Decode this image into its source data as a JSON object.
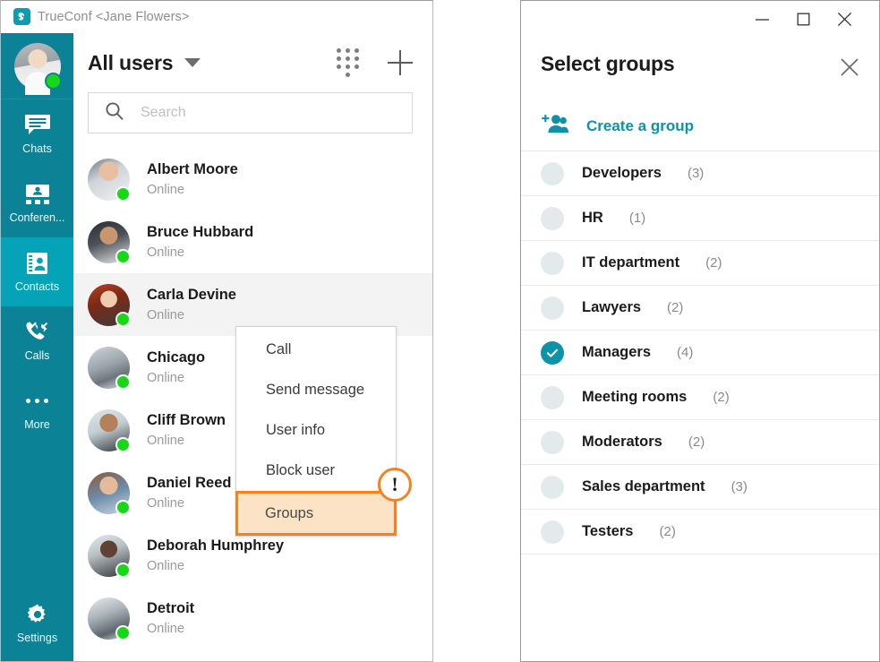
{
  "app": {
    "titlebar": {
      "brand": "TrueConf",
      "user": "<Jane Flowers>",
      "logo_icon": "trueconf-logo-icon"
    },
    "accent_teal": "#0b8296",
    "accent_teal_active": "#05a3b8",
    "accent_link": "#0c93a8",
    "highlight_orange": "#f58220",
    "highlight_fill": "#fde3c5",
    "presence_green": "#16d816"
  },
  "sidebar": {
    "profile": {
      "name": "Jane Flowers",
      "presence": "online",
      "avatar_icon": "avatar"
    },
    "items": [
      {
        "label": "Chats",
        "icon": "chat-bubble-icon",
        "active": false
      },
      {
        "label": "Conferen...",
        "icon": "conference-icon",
        "active": false
      },
      {
        "label": "Contacts",
        "icon": "contacts-card-icon",
        "active": true
      },
      {
        "label": "Calls",
        "icon": "call-arrows-icon",
        "active": false
      },
      {
        "label": "More",
        "icon": "ellipsis-icon",
        "active": false
      }
    ],
    "settings": {
      "label": "Settings",
      "icon": "gear-icon"
    }
  },
  "main": {
    "header": {
      "title": "All users",
      "dropdown_icon": "chevron-down-icon",
      "dialpad_icon": "dialpad-icon",
      "add_icon": "plus-icon"
    },
    "search": {
      "placeholder": "Search",
      "value": "",
      "icon": "search-icon"
    },
    "contacts": [
      {
        "name": "Albert Moore",
        "status": "Online",
        "selected": false
      },
      {
        "name": "Bruce Hubbard",
        "status": "Online",
        "selected": false
      },
      {
        "name": "Carla Devine",
        "status": "Online",
        "selected": true
      },
      {
        "name": "Chicago",
        "status": "Online",
        "selected": false
      },
      {
        "name": "Cliff Brown",
        "status": "Online",
        "selected": false
      },
      {
        "name": "Daniel Reed",
        "status": "Online",
        "selected": false
      },
      {
        "name": "Deborah Humphrey",
        "status": "Online",
        "selected": false
      },
      {
        "name": "Detroit",
        "status": "Online",
        "selected": false
      }
    ]
  },
  "context_menu": {
    "items": [
      {
        "label": "Call",
        "highlighted": false
      },
      {
        "label": "Send message",
        "highlighted": false
      },
      {
        "label": "User info",
        "highlighted": false
      },
      {
        "label": "Block user",
        "highlighted": false
      },
      {
        "label": "Groups",
        "highlighted": true
      }
    ],
    "badge": {
      "text": "!",
      "icon": "exclamation-badge-icon"
    }
  },
  "dialog": {
    "window_controls": {
      "minimize_icon": "minimize-icon",
      "maximize_icon": "maximize-icon",
      "close_icon": "close-icon"
    },
    "title": "Select groups",
    "close_icon": "close-icon",
    "create_group": {
      "label": "Create a group",
      "icon": "add-group-icon"
    },
    "groups": [
      {
        "name": "Developers",
        "count": "(3)",
        "selected": false
      },
      {
        "name": "HR",
        "count": "(1)",
        "selected": false
      },
      {
        "name": "IT department",
        "count": "(2)",
        "selected": false
      },
      {
        "name": "Lawyers",
        "count": "(2)",
        "selected": false
      },
      {
        "name": "Managers",
        "count": "(4)",
        "selected": true
      },
      {
        "name": "Meeting rooms",
        "count": "(2)",
        "selected": false
      },
      {
        "name": "Moderators",
        "count": "(2)",
        "selected": false
      },
      {
        "name": "Sales department",
        "count": "(3)",
        "selected": false
      },
      {
        "name": "Testers",
        "count": "(2)",
        "selected": false
      }
    ]
  }
}
